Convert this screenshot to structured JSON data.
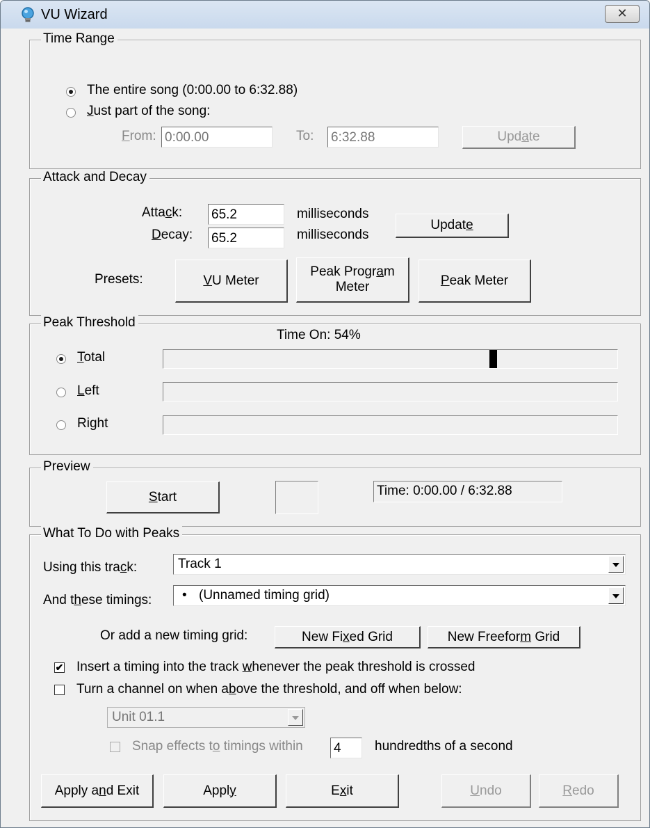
{
  "window": {
    "title": "VU Wizard",
    "close_symbol": "✕"
  },
  "time_range": {
    "legend": "Time Range",
    "entire_song_label": "The entire song (0:00.00 to 6:32.88)",
    "part_label": "Just part of the song:",
    "from_label": "From:",
    "from_value": "0:00.00",
    "to_label": "To:",
    "to_value": "6:32.88",
    "update_label": "Update",
    "selected": "entire"
  },
  "attack_decay": {
    "legend": "Attack and Decay",
    "attack_label": "Attack:",
    "attack_value": "65.2",
    "attack_unit": "milliseconds",
    "decay_label": "Decay:",
    "decay_value": "65.2",
    "decay_unit": "milliseconds",
    "update_label": "Update",
    "presets_label": "Presets:",
    "preset_vu": "VU Meter",
    "preset_ppm_line1": "Peak Program",
    "preset_ppm_line2": "Meter",
    "preset_peak": "Peak Meter"
  },
  "peak_threshold": {
    "legend": "Peak Threshold",
    "time_on": "Time On: 54%",
    "total_label": "Total",
    "left_label": "Left",
    "right_label": "Right",
    "selected": "total",
    "total_level": 0.73
  },
  "preview": {
    "legend": "Preview",
    "start_label": "Start",
    "time_text": "Time: 0:00.00 / 6:32.88"
  },
  "peaks": {
    "legend": "What To Do with Peaks",
    "track_label": "Using this track:",
    "track_value": "Track 1",
    "timings_label": "And these timings:",
    "timings_bullet": "•",
    "timings_value": "(Unnamed timing grid)",
    "add_grid_label": "Or add a new timing grid:",
    "new_fixed_label": "New Fixed Grid",
    "new_freeform_label": "New Freeform Grid",
    "insert_timing_label": "Insert a timing into the track whenever the peak threshold is crossed",
    "insert_timing_checked": true,
    "turn_channel_label": "Turn a channel on when above the threshold, and off when below:",
    "turn_channel_checked": false,
    "channel_value": "Unit 01.1",
    "snap_label": "Snap effects to timings within",
    "snap_value": "4",
    "snap_unit": "hundredths of a second"
  },
  "footer": {
    "apply_exit": "Apply and Exit",
    "apply": "Apply",
    "exit": "Exit",
    "undo": "Undo",
    "redo": "Redo"
  }
}
